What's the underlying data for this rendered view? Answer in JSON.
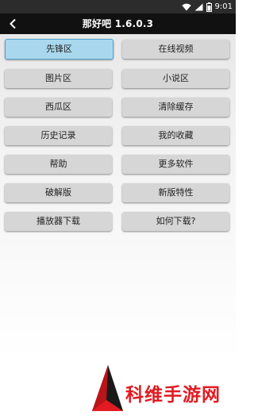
{
  "status_bar": {
    "time": "9:01"
  },
  "app_bar": {
    "title": "那好吧 1.6.0.3"
  },
  "menu": {
    "left": [
      "先锋区",
      "图片区",
      "西瓜区",
      "历史记录",
      "帮助",
      "破解版",
      "播放器下载"
    ],
    "right": [
      "在线视频",
      "小说区",
      "清除缓存",
      "我的收藏",
      "更多软件",
      "新版特性",
      "如何下载?"
    ],
    "selected": "先锋区"
  },
  "watermark": {
    "text": "科维手游网"
  },
  "colors": {
    "selected_bg": "#a9d8ee",
    "button_bg": "#d6d6d6",
    "appbar_bg": "#111111",
    "watermark_red": "#e21a22"
  }
}
